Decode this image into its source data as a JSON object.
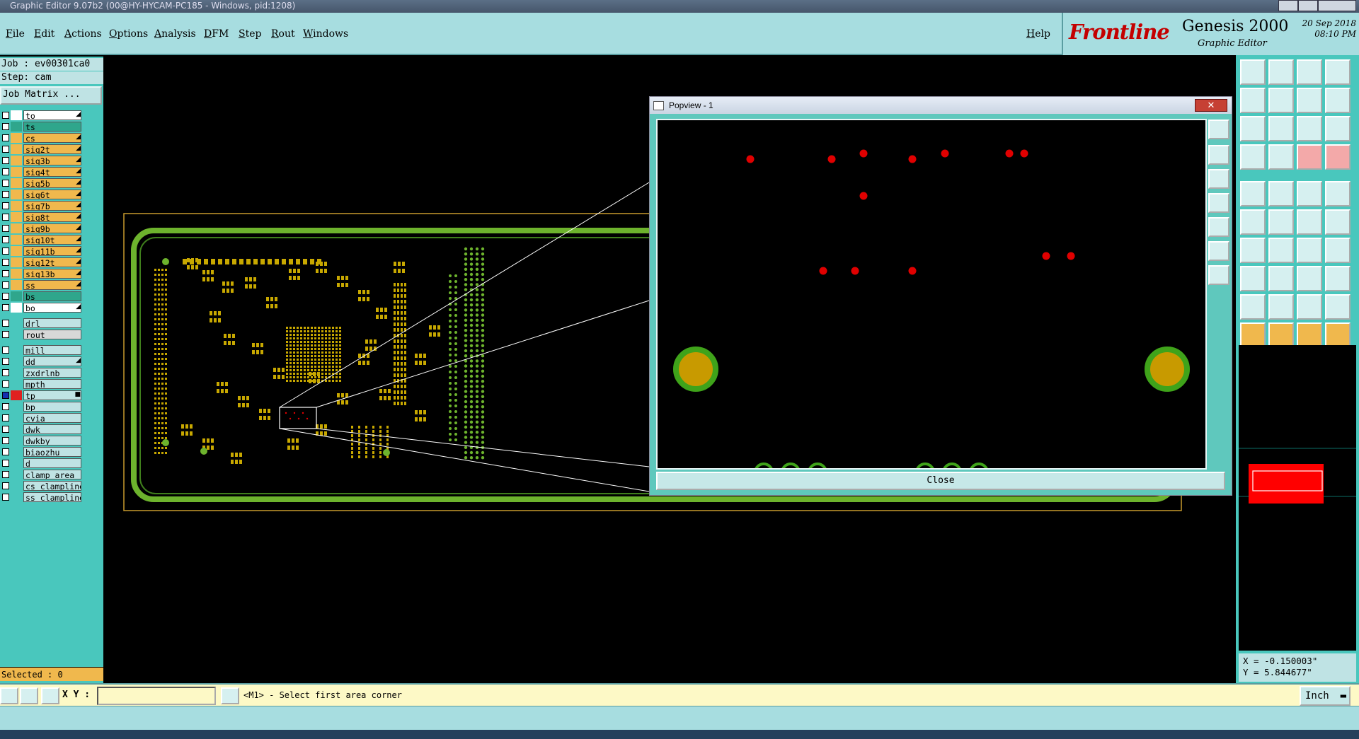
{
  "window": {
    "title": "Graphic Editor 9.07b2 (00@HY-HYCAM-PC185 - Windows, pid:1208)"
  },
  "menu": {
    "items": [
      "File",
      "Edit",
      "Actions",
      "Options",
      "Analysis",
      "DFM",
      "Step",
      "Rout",
      "Windows"
    ],
    "help": "Help"
  },
  "brand": {
    "logo": "Frontline",
    "product": "Genesis 2000",
    "subtitle": "Graphic Editor",
    "date": "20 Sep 2018",
    "time": "08:10 PM"
  },
  "left": {
    "job": "Job : ev00301ca0",
    "step": "Step: cam",
    "job_matrix": "Job Matrix ...",
    "layers": [
      {
        "name": "to",
        "color": "#ffffff",
        "swatch": "#ffffff",
        "arrow": "◢",
        "checked": false
      },
      {
        "name": "ts",
        "color": "#2fa68c",
        "swatch": "#2fa68c",
        "arrow": "",
        "checked": false
      },
      {
        "name": "cs",
        "color": "#f0b84d",
        "swatch": "#f0b84d",
        "arrow": "◢",
        "checked": false
      },
      {
        "name": "sig2t",
        "color": "#f0b84d",
        "swatch": "#f0b84d",
        "arrow": "◢",
        "checked": false
      },
      {
        "name": "sig3b",
        "color": "#f0b84d",
        "swatch": "#f0b84d",
        "arrow": "◢",
        "checked": false
      },
      {
        "name": "sig4t",
        "color": "#f0b84d",
        "swatch": "#f0b84d",
        "arrow": "◢",
        "checked": false
      },
      {
        "name": "sig5b",
        "color": "#f0b84d",
        "swatch": "#f0b84d",
        "arrow": "◢",
        "checked": false
      },
      {
        "name": "sig6t",
        "color": "#f0b84d",
        "swatch": "#f0b84d",
        "arrow": "◢",
        "checked": false
      },
      {
        "name": "sig7b",
        "color": "#f0b84d",
        "swatch": "#f0b84d",
        "arrow": "◢",
        "checked": false
      },
      {
        "name": "sig8t",
        "color": "#f0b84d",
        "swatch": "#f0b84d",
        "arrow": "◢",
        "checked": false
      },
      {
        "name": "sig9b",
        "color": "#f0b84d",
        "swatch": "#f0b84d",
        "arrow": "◢",
        "checked": false
      },
      {
        "name": "sig10t",
        "color": "#f0b84d",
        "swatch": "#f0b84d",
        "arrow": "◢",
        "checked": false
      },
      {
        "name": "sig11b",
        "color": "#f0b84d",
        "swatch": "#f0b84d",
        "arrow": "◢",
        "checked": false
      },
      {
        "name": "sig12t",
        "color": "#f0b84d",
        "swatch": "#f0b84d",
        "arrow": "◢",
        "checked": false
      },
      {
        "name": "sig13b",
        "color": "#f0b84d",
        "swatch": "#f0b84d",
        "arrow": "◢",
        "checked": false
      },
      {
        "name": "ss",
        "color": "#f0b84d",
        "swatch": "#f0b84d",
        "arrow": "◢",
        "checked": false
      },
      {
        "name": "bs",
        "color": "#2fa68c",
        "swatch": "#2fa68c",
        "arrow": "",
        "checked": false
      },
      {
        "name": "bo",
        "color": "#ffffff",
        "swatch": "#ffffff",
        "arrow": "◢",
        "checked": false
      },
      {
        "name": "drl",
        "color": "#bfe3e4",
        "swatch": "#49c7bd",
        "arrow": "",
        "checked": false
      },
      {
        "name": "rout",
        "color": "#d8d8d8",
        "swatch": "#49c7bd",
        "arrow": "",
        "checked": false
      },
      {
        "name": "mill",
        "color": "#bfe3e4",
        "swatch": "#49c7bd",
        "arrow": "",
        "checked": false
      },
      {
        "name": "dd",
        "color": "#bfe3e4",
        "swatch": "#49c7bd",
        "arrow": "◢",
        "checked": false
      },
      {
        "name": "zxdrlnb",
        "color": "#bfe3e4",
        "swatch": "#49c7bd",
        "arrow": "",
        "checked": false
      },
      {
        "name": "mpth",
        "color": "#bfe3e4",
        "swatch": "#49c7bd",
        "arrow": "",
        "checked": false
      },
      {
        "name": "tp",
        "color": "#bfe3e4",
        "swatch": "#e02020",
        "arrow": "■",
        "checked": true
      },
      {
        "name": "bp",
        "color": "#bfe3e4",
        "swatch": "#49c7bd",
        "arrow": "",
        "checked": false
      },
      {
        "name": "cvia",
        "color": "#bfe3e4",
        "swatch": "#49c7bd",
        "arrow": "",
        "checked": false
      },
      {
        "name": "dwk",
        "color": "#bfe3e4",
        "swatch": "#49c7bd",
        "arrow": "",
        "checked": false
      },
      {
        "name": "dwkby",
        "color": "#bfe3e4",
        "swatch": "#49c7bd",
        "arrow": "",
        "checked": false
      },
      {
        "name": "biaozhu",
        "color": "#bfe3e4",
        "swatch": "#49c7bd",
        "arrow": "",
        "checked": false
      },
      {
        "name": "d",
        "color": "#bfe3e4",
        "swatch": "#49c7bd",
        "arrow": "",
        "checked": false
      },
      {
        "name": "clamp_area",
        "color": "#bfe3e4",
        "swatch": "#49c7bd",
        "arrow": "",
        "checked": false
      },
      {
        "name": "cs_clampline",
        "color": "#bfe3e4",
        "swatch": "#49c7bd",
        "arrow": "",
        "checked": false
      },
      {
        "name": "ss_clampline",
        "color": "#bfe3e4",
        "swatch": "#49c7bd",
        "arrow": "",
        "checked": false
      }
    ],
    "selected": "Selected : 0"
  },
  "popview": {
    "title": "Popview - 1",
    "close_button": "Close"
  },
  "coords": {
    "x": "X = -0.150003\"",
    "y": "Y = 5.844677\""
  },
  "status": {
    "xy_label": "X Y :",
    "xy_value": "",
    "prompt": "<M1> - Select first area corner",
    "units": "Inch"
  },
  "colors": {
    "panel": "#49c7bd",
    "menu": "#a7dde0",
    "board_outline": "#6db32d",
    "pad": "#c8a800",
    "target": "#e00000"
  }
}
